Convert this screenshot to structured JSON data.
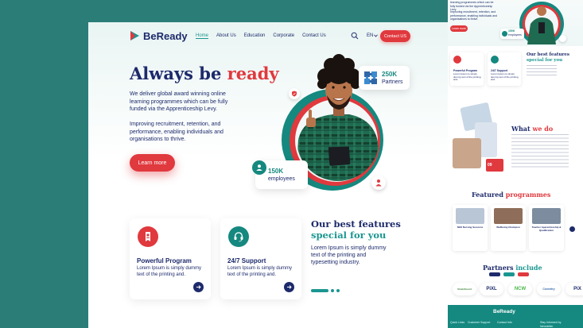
{
  "nav": {
    "logo_text": "BeReady",
    "links": [
      "Home",
      "About Us",
      "Education",
      "Corporate",
      "Contact Us"
    ],
    "language": "EN",
    "contact_button": "Contact US"
  },
  "hero": {
    "title_main": "Always be",
    "title_accent": "ready",
    "paragraph1": "We deliver global award winning online learning programmes which can be fully funded via the Apprenticeship Levy.",
    "paragraph2": "Improving recruitment, retention, and performance, enabling individuals and organisations to thrive.",
    "button": "Learn more",
    "stat_partners_value": "250K",
    "stat_partners_label": "Partners",
    "stat_employees_value": "150K",
    "stat_employees_label": "employees"
  },
  "features": {
    "cards": [
      {
        "title": "Powerful Program",
        "text": "Lorem Ipsum is simply dummy text of the printing and."
      },
      {
        "title": "24/7 Support",
        "text": "Lorem Ipsum is simply dummy text of the printing and."
      }
    ],
    "heading_line1": "Our best features",
    "heading_line2": "special for you",
    "description": "Lorem Ipsum is simply dummy text of the printing and typesetting industry."
  },
  "preview": {
    "top_text1": "learning programmes which can be fully funded via the Apprenticeship Levy.",
    "top_text2": "Improving recruitment, retention, and performance, enabling individuals and organisations to thrive.",
    "button": "Learn more",
    "employees_value": "150K",
    "employees_label": "employees",
    "card1_title": "Powerful Program",
    "card2_title": "24/7 Support",
    "card_text": "Lorem Ipsum is simply dummy text of the printing and.",
    "best_line1": "Our best features",
    "best_line2": "special for you",
    "what_we_do_main": "What",
    "what_we_do_accent": "we do",
    "badge_value": "09",
    "featured_main": "Featured",
    "featured_accent": "programmes",
    "programs": [
      "NHS Nursing Sessions",
      "Wellbeing Champion",
      "Teacher Apprenticeship & Qualification"
    ],
    "partners_main": "Partners",
    "partners_accent": "include",
    "partner_logos": [
      "ShieldGuard",
      "PiXL",
      "NCW",
      "Coventry",
      "PiX"
    ],
    "footer_logo": "BeReady",
    "footer_cols": [
      "Quick Links",
      "Customer Support",
      "Contact Info",
      "Stay Informed by Newsletter"
    ]
  },
  "colors": {
    "navy": "#1d2a6b",
    "teal": "#1a9690",
    "red": "#e0393e",
    "background": "#2b7d78"
  }
}
